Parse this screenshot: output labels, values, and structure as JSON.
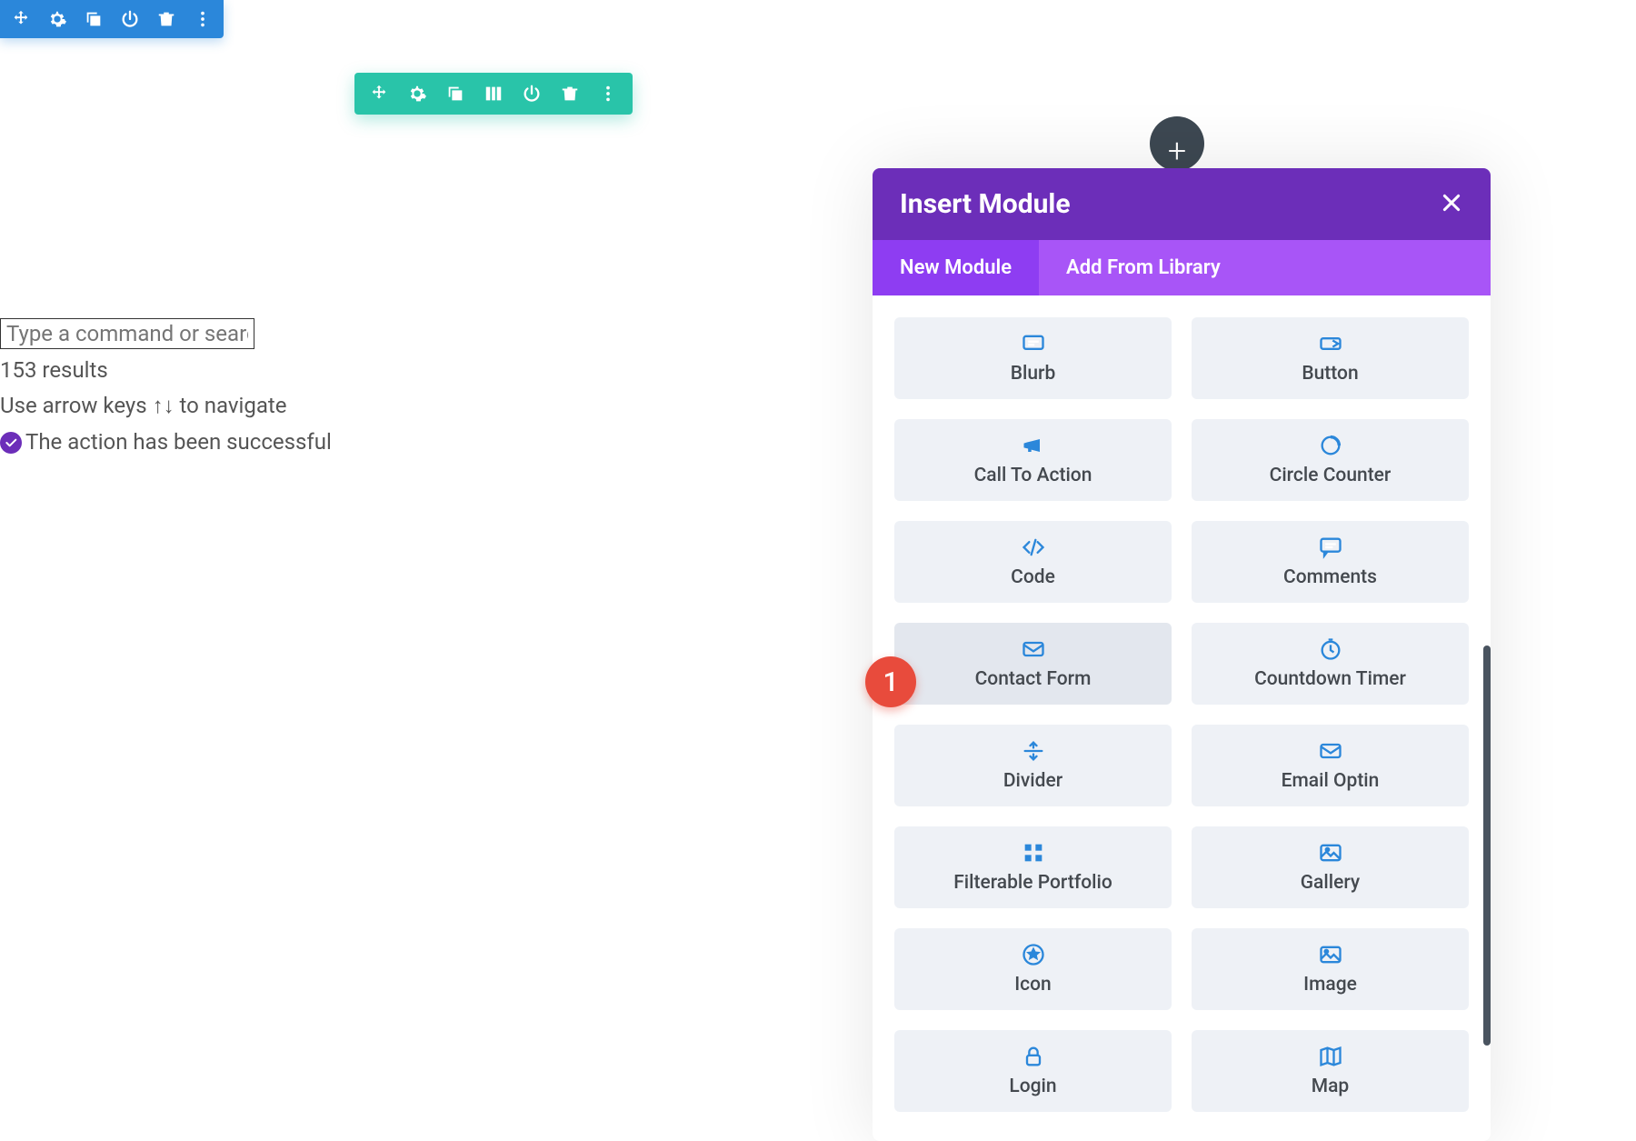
{
  "section_toolbar": {
    "buttons": [
      "move",
      "settings",
      "duplicate",
      "power",
      "delete",
      "more"
    ]
  },
  "row_toolbar": {
    "buttons": [
      "move",
      "settings",
      "duplicate",
      "columns",
      "power",
      "delete",
      "more"
    ]
  },
  "command": {
    "placeholder": "Type a command or search",
    "results_text": "153 results",
    "nav_hint": "Use arrow keys ↑↓ to navigate",
    "success_text": "The action has been successful"
  },
  "modal": {
    "title": "Insert Module",
    "tabs": {
      "new": "New Module",
      "library": "Add From Library"
    },
    "modules": [
      {
        "label": "Blurb",
        "icon": "blurb"
      },
      {
        "label": "Button",
        "icon": "button"
      },
      {
        "label": "Call To Action",
        "icon": "megaphone"
      },
      {
        "label": "Circle Counter",
        "icon": "circlecounter"
      },
      {
        "label": "Code",
        "icon": "code"
      },
      {
        "label": "Comments",
        "icon": "comments"
      },
      {
        "label": "Contact Form",
        "icon": "mail",
        "hover": true
      },
      {
        "label": "Countdown Timer",
        "icon": "timer"
      },
      {
        "label": "Divider",
        "icon": "divider"
      },
      {
        "label": "Email Optin",
        "icon": "mail"
      },
      {
        "label": "Filterable Portfolio",
        "icon": "grid"
      },
      {
        "label": "Gallery",
        "icon": "gallery"
      },
      {
        "label": "Icon",
        "icon": "iconstar"
      },
      {
        "label": "Image",
        "icon": "image"
      },
      {
        "label": "Login",
        "icon": "lock"
      },
      {
        "label": "Map",
        "icon": "map"
      }
    ]
  },
  "annotation": {
    "label": "1"
  }
}
